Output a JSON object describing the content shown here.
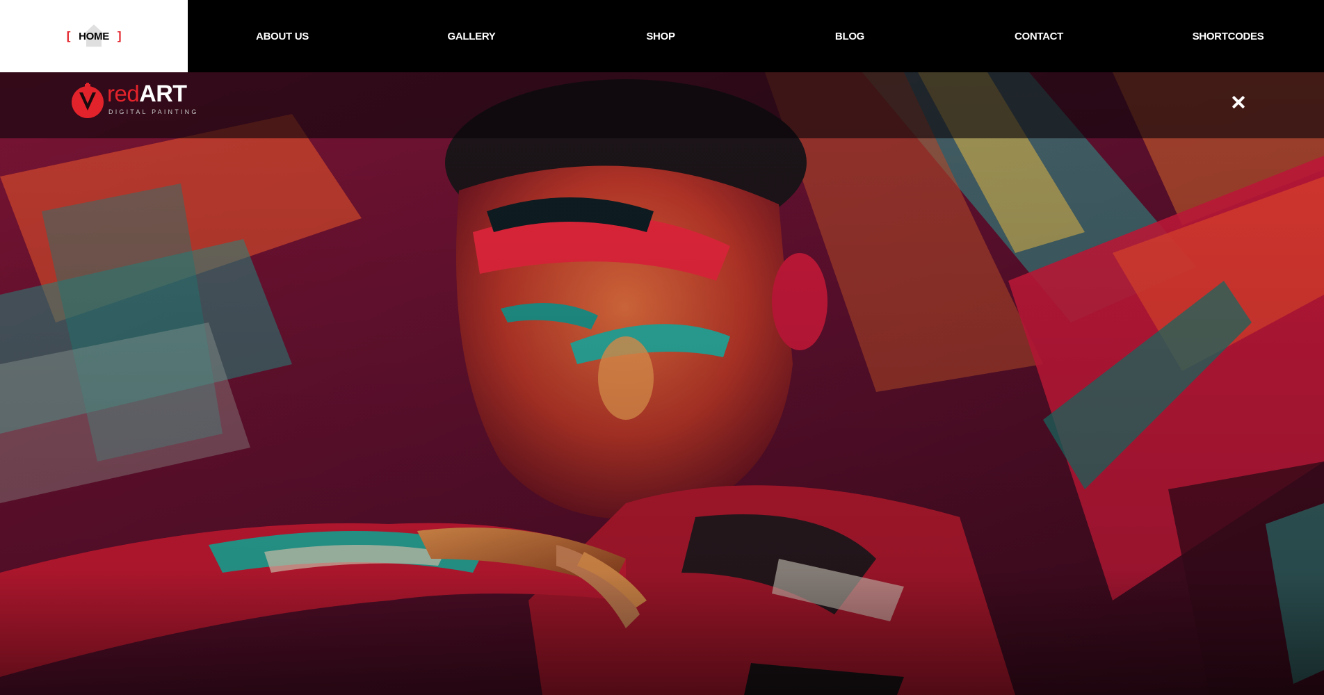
{
  "nav": {
    "items": [
      {
        "label": "HOME"
      },
      {
        "label": "ABOUT US"
      },
      {
        "label": "GALLERY"
      },
      {
        "label": "SHOP"
      },
      {
        "label": "BLOG"
      },
      {
        "label": "CONTACT"
      },
      {
        "label": "SHORTCODES"
      }
    ],
    "active_left_bracket": "[",
    "active_right_bracket": "]"
  },
  "brand": {
    "name_part1": "red",
    "name_part2": "ART",
    "tagline": "DIGITAL PAINTING",
    "icon": "paintbrush-drop-icon"
  },
  "header": {
    "close_icon": "close-icon"
  },
  "hero": {
    "image_description_icon": "hero-image"
  },
  "colors": {
    "accent": "#e3232b",
    "nav_bg": "#000000",
    "nav_active_bg": "#ffffff",
    "paint_red": "#c8123a",
    "paint_teal": "#1f8f86",
    "paint_copper": "#c86a3a"
  }
}
